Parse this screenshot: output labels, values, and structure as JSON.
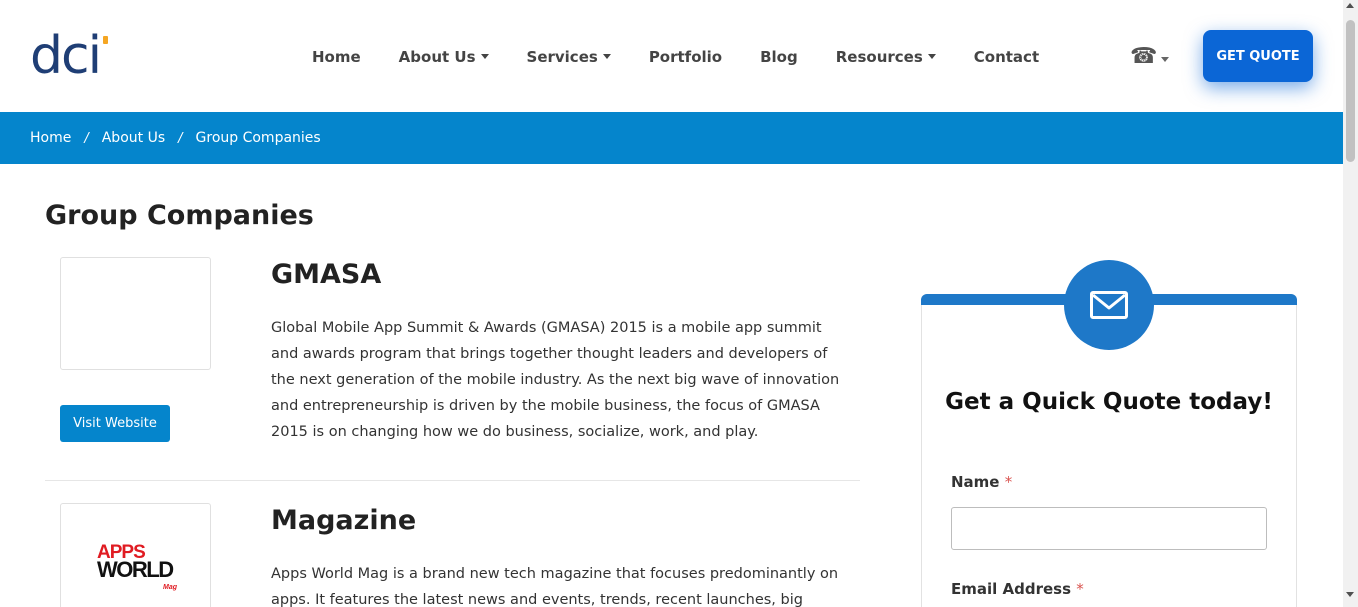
{
  "header": {
    "logo_text": "dci",
    "nav": [
      {
        "label": "Home",
        "dropdown": false
      },
      {
        "label": "About Us",
        "dropdown": true
      },
      {
        "label": "Services",
        "dropdown": true
      },
      {
        "label": "Portfolio",
        "dropdown": false
      },
      {
        "label": "Blog",
        "dropdown": false
      },
      {
        "label": "Resources",
        "dropdown": true
      },
      {
        "label": "Contact",
        "dropdown": false
      }
    ],
    "phone_icon": "phone-icon",
    "cta_label": "GET QUOTE"
  },
  "breadcrumb": {
    "items": [
      "Home",
      "About Us",
      "Group Companies"
    ],
    "separator": "/"
  },
  "main": {
    "title": "Group Companies",
    "companies": [
      {
        "name": "GMASA",
        "description": "Global Mobile App Summit & Awards (GMASA) 2015 is a mobile app summit and awards program that brings together thought leaders and developers of the next generation of the mobile industry. As the next big wave of innovation and entrepreneurship is driven by the mobile business, the focus of GMASA 2015 is on changing how we do business, socialize, work, and play.",
        "button_label": "Visit Website"
      },
      {
        "name": "Magazine",
        "logo_line1": "APPS",
        "logo_line2": "WORLD",
        "logo_tag": "Mag",
        "description": "Apps World Mag is a brand new tech magazine that focuses predominantly on apps. It features the latest news and events, trends, recent launches, big"
      }
    ]
  },
  "sidebar": {
    "icon": "envelope-icon",
    "title": "Get a Quick Quote today!",
    "fields": [
      {
        "label": "Name",
        "required_mark": "*",
        "value": ""
      },
      {
        "label": "Email Address",
        "required_mark": "*",
        "value": ""
      }
    ]
  },
  "colors": {
    "brand_blue": "#0585cc",
    "cta_blue": "#0b66d6",
    "card_blue": "#1e78c8",
    "logo_navy": "#1f3e75",
    "logo_accent": "#f5a623"
  }
}
